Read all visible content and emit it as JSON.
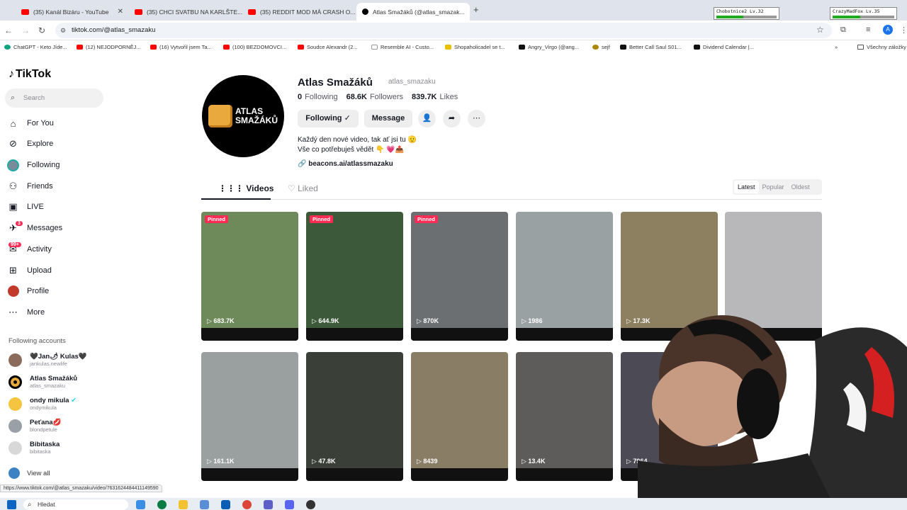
{
  "browser": {
    "tabs": [
      {
        "title": "(35) Kanál Bizáru - YouTube",
        "icon": "youtube-icon"
      },
      {
        "title": "(35) CHCI SVATBU NA KARLŠTE...",
        "icon": "youtube-icon"
      },
      {
        "title": "(35) REDDIT MOD MÁ CRASH O...",
        "icon": "youtube-icon"
      },
      {
        "title": "Atlas Smažáků (@atlas_smazak...",
        "icon": "tiktok-icon"
      }
    ],
    "url": "tiktok.com/@atlas_smazaku",
    "game_overlays": [
      {
        "name": "Chobotnice2",
        "level": "Lv.32"
      },
      {
        "name": "CrazyMadFox",
        "level": "Lv.35"
      }
    ],
    "bookmarks": [
      "ChatGPT - Keto Jíde...",
      "(12) NEJODPORNĚJ...",
      "(16) Vytvořil jsem Ta...",
      "(100) BEZDOMOVCI...",
      "Soudce Alexandr (2...",
      "Resemble AI - Custo...",
      "Shopaholicadel se t...",
      "Angry_Virgo (@ang...",
      "sejf",
      "Better Call Saul S01...",
      "Dividend Calendar |...",
      "Všechny záložky"
    ],
    "status_url": "https://www.tiktok.com/@atlas_smazaku/video/7631624484411149590"
  },
  "sidebar": {
    "logo": "TikTok",
    "search_placeholder": "Search",
    "nav": [
      {
        "label": "For You",
        "icon": "home-icon"
      },
      {
        "label": "Explore",
        "icon": "compass-icon"
      },
      {
        "label": "Following",
        "icon": "following-avatar-icon"
      },
      {
        "label": "Friends",
        "icon": "friends-icon"
      },
      {
        "label": "LIVE",
        "icon": "live-icon"
      },
      {
        "label": "Messages",
        "icon": "messages-icon",
        "badge": "3"
      },
      {
        "label": "Activity",
        "icon": "activity-icon",
        "badge": "99+"
      },
      {
        "label": "Upload",
        "icon": "upload-icon"
      },
      {
        "label": "Profile",
        "icon": "profile-icon"
      },
      {
        "label": "More",
        "icon": "more-icon"
      }
    ],
    "following_title": "Following accounts",
    "accounts": [
      {
        "name": "🖤Jan🌶 Kulas🖤",
        "handle": "jankulas.newlife"
      },
      {
        "name": "Atlas Smažáků",
        "handle": "atlas_smazaku"
      },
      {
        "name": "ondy mikula",
        "handle": "ondymikula",
        "verified": true
      },
      {
        "name": "Peťana💋",
        "handle": "blondpetule"
      },
      {
        "name": "Bibitaska",
        "handle": "bibitaska"
      }
    ],
    "view_all": "View all"
  },
  "profile": {
    "name": "Atlas Smažáků",
    "handle": "atlas_smazaku",
    "avatar_text": [
      "ATLAS",
      "SMAŽÁKŮ"
    ],
    "following_count": "0",
    "following_label": "Following",
    "followers_count": "68.6K",
    "followers_label": "Followers",
    "likes_count": "839.7K",
    "likes_label": "Likes",
    "btn_following": "Following ✓",
    "btn_message": "Message",
    "bio_line1": "Každý den nové video, tak ať jsi tu 🫡",
    "bio_line2": "Vše co potřebuješ vědět 👇 💗📤",
    "link": "beacons.ai/atlassmazaku"
  },
  "content_tabs": {
    "videos": "Videos",
    "liked": "Liked",
    "sort": [
      "Latest",
      "Popular",
      "Oldest"
    ],
    "sort_selected": "Latest"
  },
  "videos": [
    {
      "views": "683.7K",
      "pinned": "Pinned",
      "bg": "#6f8a5a"
    },
    {
      "views": "644.9K",
      "pinned": "Pinned",
      "bg": "#3c5a3a"
    },
    {
      "views": "870K",
      "pinned": "Pinned",
      "bg": "#6b6f72"
    },
    {
      "views": "1986",
      "pinned": "",
      "bg": "#9aa1a3"
    },
    {
      "views": "17.3K",
      "pinned": "",
      "bg": "#8c8061"
    },
    {
      "views": "",
      "pinned": "",
      "bg": "#b8b8bb"
    },
    {
      "views": "161.1K",
      "pinned": "",
      "bg": "#9a9fa0"
    },
    {
      "views": "47.8K",
      "pinned": "",
      "bg": "#3a4038"
    },
    {
      "views": "8439",
      "pinned": "",
      "bg": "#8a7d66"
    },
    {
      "views": "13.4K",
      "pinned": "",
      "bg": "#5d5c5a"
    },
    {
      "views": "7964",
      "pinned": "",
      "bg": "#4c4a55"
    }
  ],
  "taskbar": {
    "search_placeholder": "Hledat"
  }
}
